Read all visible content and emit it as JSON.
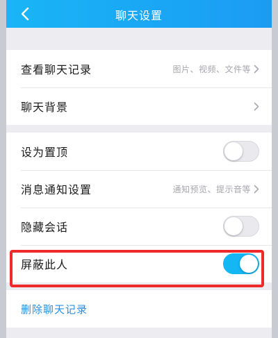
{
  "header": {
    "title": "聊天设置",
    "back_icon": "chevron-left-icon"
  },
  "group1": {
    "items": [
      {
        "label": "查看聊天记录",
        "hint": "图片、视频、文件等"
      },
      {
        "label": "聊天背景",
        "hint": ""
      }
    ]
  },
  "group2": {
    "items": [
      {
        "label": "设为置顶",
        "toggle": false
      },
      {
        "label": "消息通知设置",
        "hint": "通知预览、提示音等"
      },
      {
        "label": "隐藏会话",
        "toggle": false
      },
      {
        "label": "屏蔽此人",
        "toggle": true
      }
    ]
  },
  "group3": {
    "delete_label": "删除聊天记录"
  },
  "colors": {
    "header": "#1aa8f5",
    "toggle_on": "#14b6f3",
    "link": "#2a8fe0",
    "highlight": "#ee2a2a"
  }
}
